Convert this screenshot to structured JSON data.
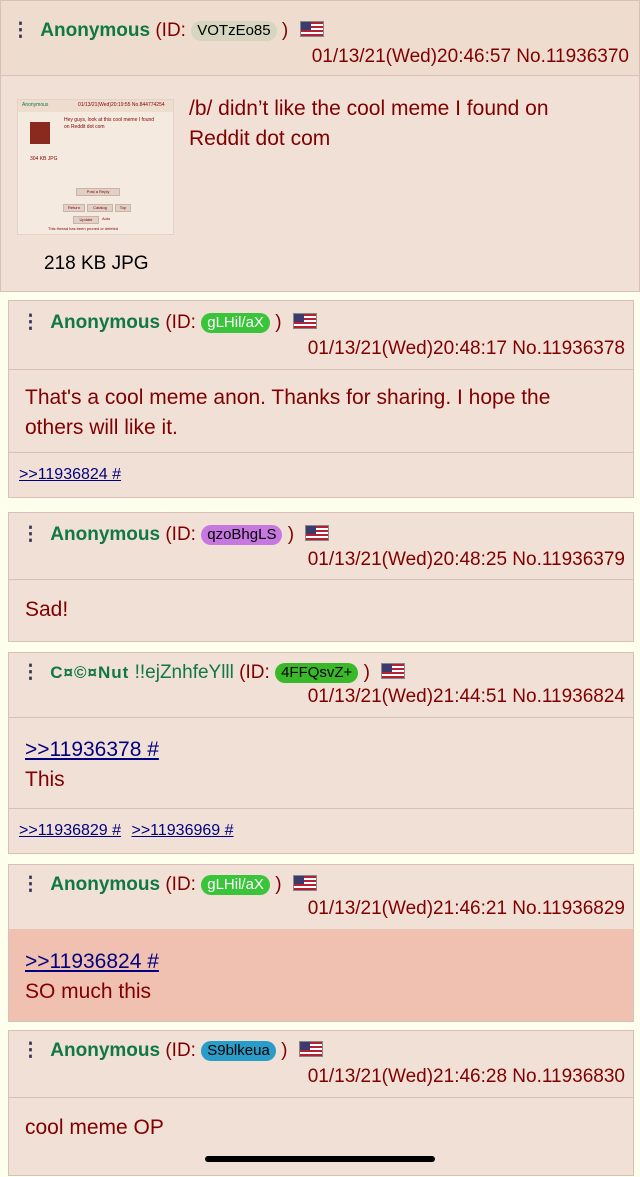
{
  "posts": [
    {
      "name": "Anonymous",
      "id_label": "(ID:",
      "id": "VOTzEo85",
      "id_close": ")",
      "datetime": "01/13/21(Wed)20:46:57",
      "number": "No.11936370",
      "text1": "/b/ didn’t like the cool meme I found on",
      "text2": "Reddit dot com",
      "file_info": "218 KB JPG",
      "colors": {
        "id_bg": "#D6D6C0",
        "id_fg": "#000000"
      }
    },
    {
      "name": "Anonymous",
      "id_label": "(ID:",
      "id": "gLHil/aX",
      "id_close": ")",
      "datetime": "01/13/21(Wed)20:48:17",
      "number": "No.11936378",
      "text1": "That's a cool meme anon. Thanks for sharing. I hope the",
      "text2": "others will like it.",
      "replies": ">>11936824 #",
      "colors": {
        "id_bg": "#39C43A",
        "id_fg": "#FFFFFF"
      }
    },
    {
      "name": "Anonymous",
      "id_label": "(ID:",
      "id": "qzoBhgLS",
      "id_close": ")",
      "datetime": "01/13/21(Wed)20:48:25",
      "number": "No.11936379",
      "text1": "Sad!",
      "colors": {
        "id_bg": "#C777E0",
        "id_fg": "#000000"
      }
    },
    {
      "name": "C¤©¤Nut",
      "tripcode": "!!ejZnhfeYlll",
      "id_label": "(ID:",
      "id": "4FFQsvZ+",
      "id_close": ")",
      "datetime": "01/13/21(Wed)21:44:51",
      "number": "No.11936824",
      "quote": ">>11936378 #",
      "text1": "This",
      "replies": ">>11936829 #",
      "replies2": ">>11936969 #",
      "colors": {
        "id_bg": "#39B82A",
        "id_fg": "#000000"
      }
    },
    {
      "name": "Anonymous",
      "id_label": "(ID:",
      "id": "gLHil/aX",
      "id_close": ")",
      "datetime": "01/13/21(Wed)21:46:21",
      "number": "No.11936829",
      "quote": ">>11936824 #",
      "text1": "SO much this",
      "colors": {
        "id_bg": "#39C43A",
        "id_fg": "#FFFFFF"
      }
    },
    {
      "name": "Anonymous",
      "id_label": "(ID:",
      "id": "S9blkeua",
      "id_close": ")",
      "datetime": "01/13/21(Wed)21:46:28",
      "number": "No.11936830",
      "text1": "cool meme OP",
      "colors": {
        "id_bg": "#2A9CC8",
        "id_fg": "#000000"
      }
    }
  ],
  "thumbnail": {
    "header_name": "Anonymous",
    "header_meta": "01/13/21(Wed)20:19:55 No.844774254",
    "line1": "Hey guys, look at this cool meme I found",
    "line2": "on Reddit dot com",
    "file": "304 KB JPG",
    "btn_reply": "Post a Reply",
    "btn_return": "Return",
    "btn_catalog": "Catalog",
    "btn_top": "Top",
    "btn_update": "Update",
    "btn_auto": "Auto",
    "pruned": "This thread has been pruned or deleted"
  }
}
